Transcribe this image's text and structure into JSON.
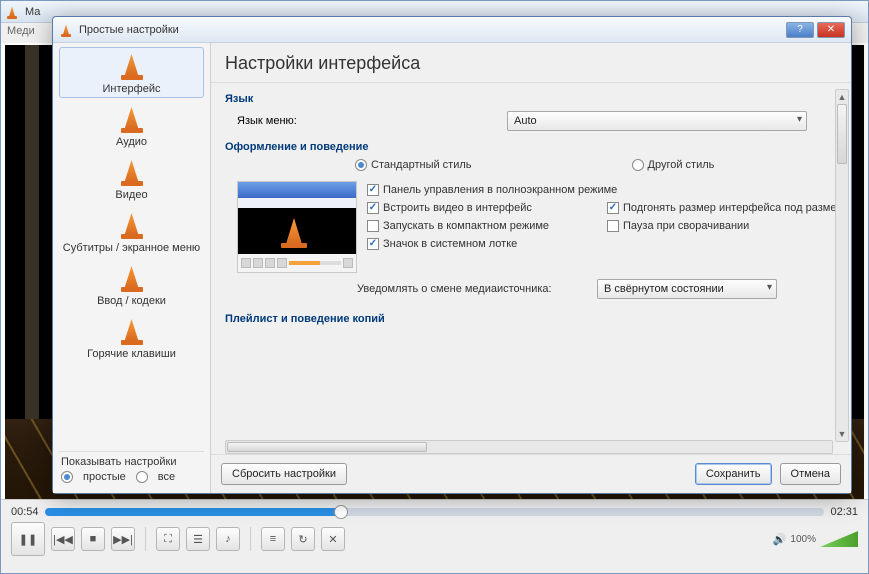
{
  "outer": {
    "title_fragment": "Ма",
    "menu_fragment": "Меди",
    "time_current": "00:54",
    "time_total": "02:31",
    "volume_percent": "100%"
  },
  "dialog": {
    "title": "Простые настройки",
    "sidebar": {
      "items": [
        {
          "label": "Интерфейс"
        },
        {
          "label": "Аудио"
        },
        {
          "label": "Видео"
        },
        {
          "label": "Субтитры / экранное меню"
        },
        {
          "label": "Ввод / кодеки"
        },
        {
          "label": "Горячие клавиши"
        }
      ],
      "show_settings_label": "Показывать настройки",
      "mode_simple": "простые",
      "mode_all": "все"
    },
    "header": "Настройки интерфейса",
    "language_group": "Язык",
    "language_label": "Язык меню:",
    "language_value": "Auto",
    "look_group": "Оформление и поведение",
    "style_standard": "Стандартный стиль",
    "style_other": "Другой стиль",
    "chk_fullscreen_panel": "Панель управления в полноэкранном режиме",
    "chk_embed_video": "Встроить видео в интерфейс",
    "chk_fit_size": "Подгонять размер интерфейса под разме",
    "chk_compact": "Запускать в компактном режиме",
    "chk_pause_min": "Пауза при сворачивании",
    "chk_tray": "Значок в системном лотке",
    "notify_label": "Уведомлять о смене медиаисточника:",
    "notify_value": "В свёрнутом состоянии",
    "playlist_group": "Плейлист и поведение копий",
    "footer": {
      "reset": "Сбросить настройки",
      "save": "Сохранить",
      "cancel": "Отмена"
    }
  }
}
